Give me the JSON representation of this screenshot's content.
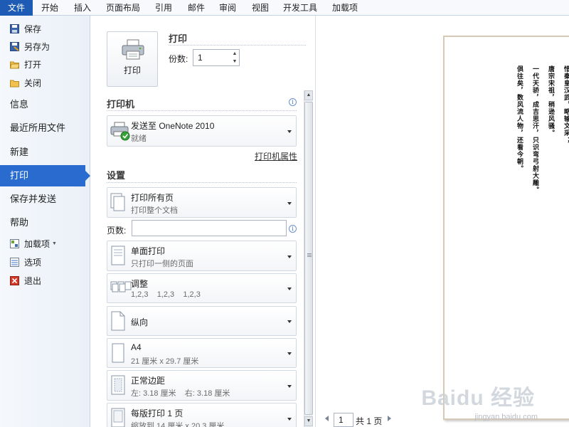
{
  "ribbon": {
    "tabs": [
      "文件",
      "开始",
      "插入",
      "页面布局",
      "引用",
      "邮件",
      "审阅",
      "视图",
      "开发工具",
      "加载项"
    ]
  },
  "nav": {
    "save": "保存",
    "save_as": "另存为",
    "open": "打开",
    "close": "关闭",
    "info": "信息",
    "recent": "最近所用文件",
    "new": "新建",
    "print": "打印",
    "save_send": "保存并发送",
    "help": "帮助",
    "addins": "加载项",
    "options": "选项",
    "exit": "退出"
  },
  "print": {
    "title": "打印",
    "button_label": "打印",
    "copies_label": "份数:",
    "copies_value": "1"
  },
  "printer": {
    "heading": "打印机",
    "name": "发送至 OneNote 2010",
    "status": "就绪",
    "properties_link": "打印机属性"
  },
  "settings": {
    "heading": "设置",
    "range_title": "打印所有页",
    "range_desc": "打印整个文档",
    "pages_label": "页数:",
    "pages_value": "",
    "sides_title": "单面打印",
    "sides_desc": "只打印一侧的页面",
    "collate_title": "调整",
    "collate_desc": "1,2,3    1,2,3    1,2,3",
    "orientation": "纵向",
    "paper_title": "A4",
    "paper_desc": "21 厘米 x 29.7 厘米",
    "margins_title": "正常边距",
    "margins_desc": "左: 3.18 厘米    右: 3.18 厘米",
    "per_sheet_title": "每版打印 1 页",
    "per_sheet_desc": "缩放到 14 厘米 x 20.3 厘米"
  },
  "preview": {
    "poem_lines": [
      "惜秦皇汉武，略输文采；",
      "唐宗宋祖，稍逊风骚。",
      "一代天骄，成吉思汗，只识弯弓射大雕。",
      "俱往矣，数风流人物，还看今朝。"
    ],
    "watermark": "Baidu 经验",
    "watermark_url": "jingyan.baidu.com",
    "page_current": "1",
    "page_total": "共 1 页"
  },
  "colors": {
    "file_tab": "#1d5bb5",
    "active_nav": "#2a6bd0"
  },
  "icons": [
    "save-icon",
    "save-as-icon",
    "open-folder-icon",
    "close-folder-icon",
    "printer-icon",
    "info-icon",
    "addins-icon",
    "options-icon",
    "exit-icon"
  ]
}
